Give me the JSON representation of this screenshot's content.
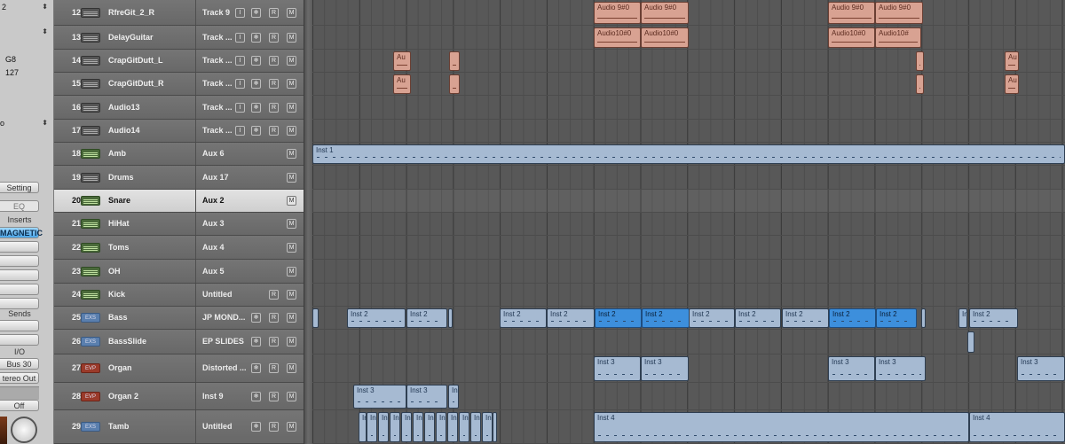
{
  "inspector": {
    "value_2": "2",
    "value_g8": "G8",
    "value_127": "127",
    "value_o": "o",
    "setting_label": "Setting",
    "eq_label": "EQ",
    "inserts_label": "Inserts",
    "magnetic_label": "MAGNETIC",
    "sends_label": "Sends",
    "io_label": "I/O",
    "bus_label": "Bus 30",
    "output_label": "tereo Out",
    "off_label": "Off",
    "knob_icon": "pan-knob-icon"
  },
  "tracks": [
    {
      "num": "12",
      "name": "RfreGit_2_R",
      "out": "Track 9",
      "icon": "audio",
      "icon_label": ""
    },
    {
      "num": "13",
      "name": "DelayGuitar",
      "out": "Track ...",
      "icon": "audio",
      "icon_label": ""
    },
    {
      "num": "14",
      "name": "CrapGitDutt_L",
      "out": "Track ...",
      "icon": "audio",
      "icon_label": ""
    },
    {
      "num": "15",
      "name": "CrapGitDutt_R",
      "out": "Track ...",
      "icon": "audio",
      "icon_label": ""
    },
    {
      "num": "16",
      "name": "Audio13",
      "out": "Track ...",
      "icon": "audio",
      "icon_label": ""
    },
    {
      "num": "17",
      "name": "Audio14",
      "out": "Track ...",
      "icon": "audio",
      "icon_label": ""
    },
    {
      "num": "18",
      "name": "Amb",
      "out": "Aux 6",
      "icon": "aux",
      "icon_label": ""
    },
    {
      "num": "19",
      "name": "Drums",
      "out": "Aux 17",
      "icon": "audio",
      "icon_label": ""
    },
    {
      "num": "20",
      "name": "Snare",
      "out": "Aux 2",
      "icon": "aux",
      "icon_label": "",
      "selected": true
    },
    {
      "num": "21",
      "name": "HiHat",
      "out": "Aux 3",
      "icon": "aux",
      "icon_label": ""
    },
    {
      "num": "22",
      "name": "Toms",
      "out": "Aux 4",
      "icon": "aux",
      "icon_label": ""
    },
    {
      "num": "23",
      "name": "OH",
      "out": "Aux 5",
      "icon": "aux",
      "icon_label": ""
    },
    {
      "num": "24",
      "name": "Kick",
      "out": "Untitled",
      "icon": "aux",
      "icon_label": ""
    },
    {
      "num": "25",
      "name": "Bass",
      "out": "JP MOND...",
      "icon": "exs",
      "icon_label": "EXS"
    },
    {
      "num": "26",
      "name": "BassSlide",
      "out": "EP SLIDES",
      "icon": "exs",
      "icon_label": "EXS"
    },
    {
      "num": "27",
      "name": "Organ",
      "out": "Distorted ...",
      "icon": "evp",
      "icon_label": "EVP"
    },
    {
      "num": "28",
      "name": "Organ 2",
      "out": "Inst 9",
      "icon": "evp",
      "icon_label": "EVP"
    },
    {
      "num": "29",
      "name": "Tamb",
      "out": "Untitled",
      "icon": "exs",
      "icon_label": "EXS"
    }
  ],
  "buttons": {
    "input": "I",
    "freeze": "❄",
    "record": "R",
    "mute": "M"
  },
  "regions": {
    "r12": [
      {
        "label": "Audio 9#0",
        "kind": "audio"
      },
      {
        "label": "Audio 9#0",
        "kind": "audio"
      },
      {
        "label": "Audio 9#0",
        "kind": "audio"
      },
      {
        "label": "Audio 9#0",
        "kind": "audio"
      }
    ],
    "r13": [
      {
        "label": "Audio10#0",
        "kind": "audio"
      },
      {
        "label": "Audio10#0",
        "kind": "audio"
      },
      {
        "label": "Audio10#0",
        "kind": "audio"
      },
      {
        "label": "Audio10#",
        "kind": "audio"
      }
    ],
    "r14": [
      {
        "label": "Au",
        "kind": "audio"
      },
      {
        "label": "",
        "kind": "audio"
      },
      {
        "label": "",
        "kind": "audio"
      },
      {
        "label": "Au",
        "kind": "audio"
      }
    ],
    "r15": [
      {
        "label": "Au",
        "kind": "audio"
      },
      {
        "label": "",
        "kind": "audio"
      },
      {
        "label": "",
        "kind": "audio"
      },
      {
        "label": "Au",
        "kind": "audio"
      }
    ],
    "r18": [
      {
        "label": "Inst 1",
        "kind": "midi"
      }
    ],
    "r25": [
      {
        "label": "",
        "kind": "midi"
      },
      {
        "label": "Inst 2",
        "kind": "midi"
      },
      {
        "label": "Inst 2",
        "kind": "midi"
      },
      {
        "label": "",
        "kind": "midi"
      },
      {
        "label": "Inst 2",
        "kind": "midi"
      },
      {
        "label": "Inst 2",
        "kind": "midi"
      },
      {
        "label": "Inst 2",
        "kind": "midi",
        "sel": true
      },
      {
        "label": "Inst 2",
        "kind": "midi",
        "sel": true
      },
      {
        "label": "Inst 2",
        "kind": "midi"
      },
      {
        "label": "Inst 2",
        "kind": "midi"
      },
      {
        "label": "Inst 2",
        "kind": "midi"
      },
      {
        "label": "Inst 2",
        "kind": "midi",
        "sel": true
      },
      {
        "label": "Inst 2",
        "kind": "midi",
        "sel": true
      },
      {
        "label": "",
        "kind": "midi"
      },
      {
        "label": "Inst 2",
        "kind": "midi"
      },
      {
        "label": "Inst 2",
        "kind": "midi"
      }
    ],
    "r26": [
      {
        "label": "",
        "kind": "midi"
      }
    ],
    "r27": [
      {
        "label": "Inst 3",
        "kind": "midi"
      },
      {
        "label": "Inst 3",
        "kind": "midi"
      },
      {
        "label": "Inst 3",
        "kind": "midi"
      },
      {
        "label": "Inst 3",
        "kind": "midi"
      },
      {
        "label": "Inst 3",
        "kind": "midi"
      }
    ],
    "r28": [
      {
        "label": "Inst 3",
        "kind": "midi"
      },
      {
        "label": "Inst 3",
        "kind": "midi"
      },
      {
        "label": "Inst 3",
        "kind": "midi"
      }
    ],
    "r29": [
      {
        "label": "In",
        "kind": "midi"
      },
      {
        "label": "In",
        "kind": "midi"
      },
      {
        "label": "In",
        "kind": "midi"
      },
      {
        "label": "In",
        "kind": "midi"
      },
      {
        "label": "In",
        "kind": "midi"
      },
      {
        "label": "In",
        "kind": "midi"
      },
      {
        "label": "In",
        "kind": "midi"
      },
      {
        "label": "In",
        "kind": "midi"
      },
      {
        "label": "In",
        "kind": "midi"
      },
      {
        "label": "In",
        "kind": "midi"
      },
      {
        "label": "In",
        "kind": "midi"
      },
      {
        "label": "In",
        "kind": "midi"
      },
      {
        "label": "In",
        "kind": "midi"
      },
      {
        "label": "Inst 4",
        "kind": "midi"
      },
      {
        "label": "Inst 4",
        "kind": "midi"
      }
    ]
  }
}
